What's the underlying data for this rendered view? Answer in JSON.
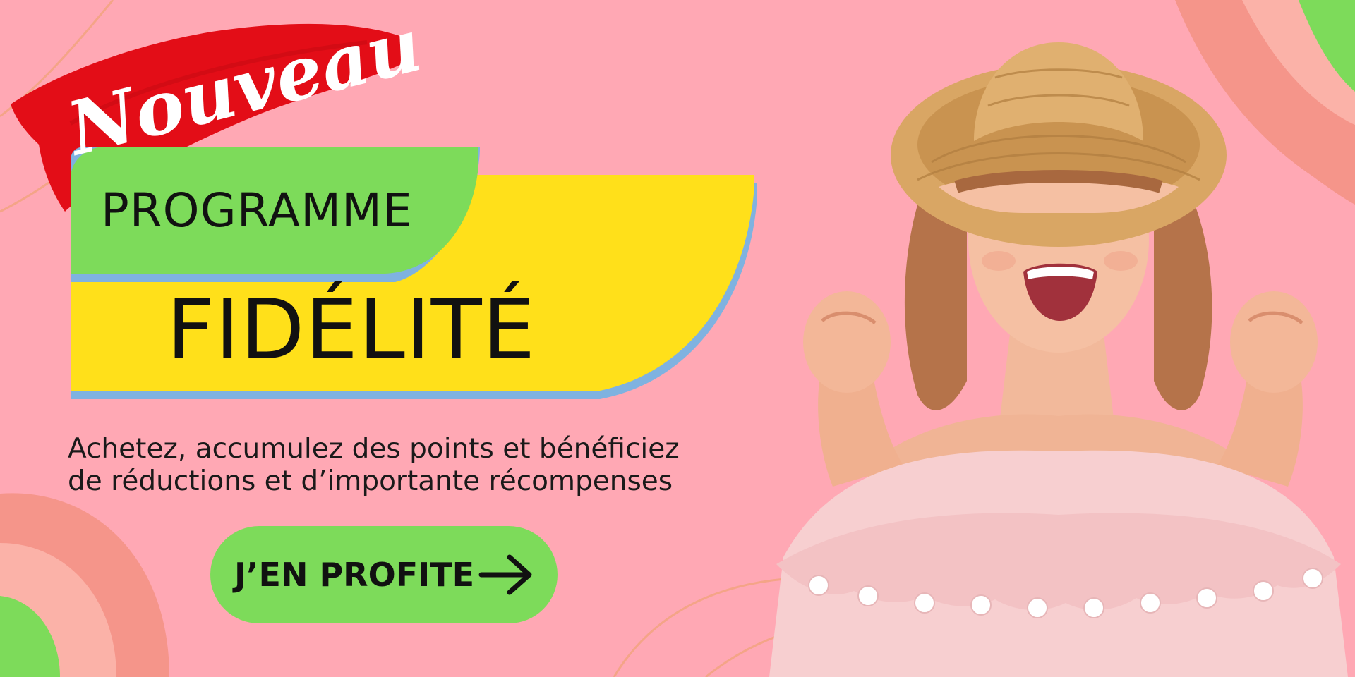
{
  "badge": {
    "text": "Nouveau"
  },
  "headline": {
    "line1": "PROGRAMME",
    "line2": "FIDÉLITÉ"
  },
  "description": {
    "line1": "Achetez, accumulez des points et bénéficiez",
    "line2": "de réductions et d’importante récompenses"
  },
  "cta": {
    "label": "J’EN PROFITE"
  },
  "colors": {
    "background": "#ffa8b4",
    "green": "#7ddb5a",
    "yellow": "#ffe01a",
    "red": "#e30d17",
    "blue_shadow": "#7fb2e0",
    "salmon": "#f5958a"
  },
  "icons": {
    "cta": "arrow-right-icon"
  }
}
